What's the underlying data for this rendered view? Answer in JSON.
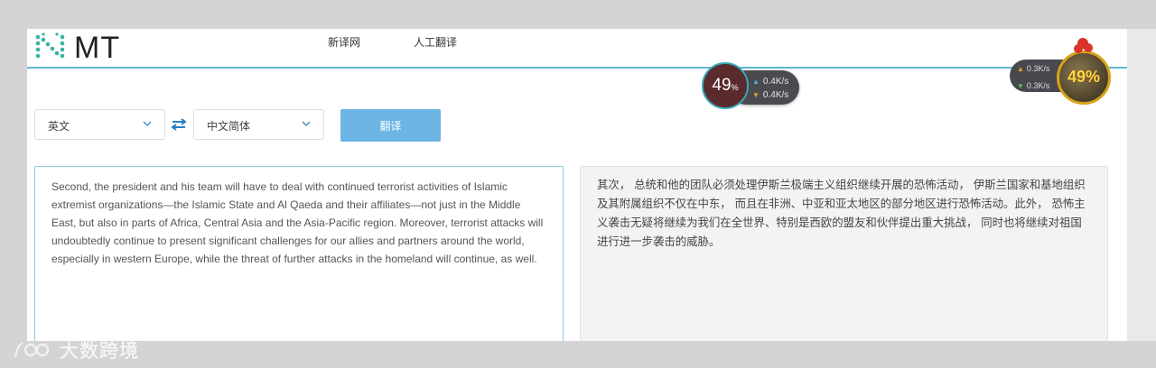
{
  "header": {
    "logo_text": "MT",
    "nav": [
      {
        "label": "新译网"
      },
      {
        "label": "人工翻译"
      }
    ]
  },
  "controls": {
    "source_language": "英文",
    "target_language": "中文简体",
    "translate_button": "翻译"
  },
  "source_text": "Second, the president and his team will have to deal with continued terrorist activities of Islamic extremist organizations—the Islamic State and Al Qaeda and their affiliates—not just in the Middle East, but also in parts of Africa, Central Asia and the Asia-Pacific region. Moreover, terrorist attacks will undoubtedly continue to present significant challenges for our allies and partners around the world, especially in western Europe, while the threat of further attacks in the homeland will continue, as well.",
  "target_text": "其次， 总统和他的团队必须处理伊斯兰极端主义组织继续开展的恐怖活动， 伊斯兰国家和基地组织及其附属组织不仅在中东， 而且在非洲、中亚和亚太地区的部分地区进行恐怖活动。此外， 恐怖主义袭击无疑将继续为我们在全世界、特别是西欧的盟友和伙伴提出重大挑战， 同时也将继续对祖国进行进一步袭击的威胁。",
  "speed_widget": {
    "percent": "49",
    "percent_sign": "%",
    "upload": "0.4K/s",
    "download": "0.4K/s"
  },
  "corner_widget": {
    "upload": "0.3K/s",
    "download": "0.3K/s",
    "percent": "49%"
  },
  "watermark": {
    "text": "大数跨境"
  },
  "colors": {
    "accent": "#5fb7cf",
    "translate_button": "#6cb5e4",
    "page_background": "#d4d4d6",
    "target_pane": "#f3f3f6"
  }
}
